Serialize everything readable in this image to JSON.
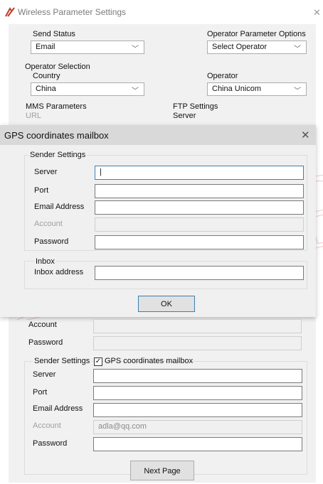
{
  "window": {
    "title": "Wireless Parameter Settings"
  },
  "send_status": {
    "label": "Send Status",
    "value": "Email"
  },
  "operator_options": {
    "label": "Operator Parameter Options",
    "value": "Select Operator"
  },
  "operator_selection": {
    "label": "Operator Selection",
    "country_label": "Country",
    "country_value": "China",
    "operator_label": "Operator",
    "operator_value": "China Unicom"
  },
  "mms": {
    "label": "MMS Parameters",
    "url_label": "URL"
  },
  "ftp": {
    "label": "FTP Settings",
    "server_label": "Server"
  },
  "dialog": {
    "title": "GPS coordinates mailbox",
    "sender_group": "Sender Settings",
    "server_label": "Server",
    "port_label": "Port",
    "email_label": "Email Address",
    "account_label": "Account",
    "password_label": "Password",
    "inbox_group": "Inbox",
    "inbox_label": "Inbox address",
    "ok_label": "OK"
  },
  "lower": {
    "account_label": "Account",
    "password_label": "Password",
    "sender_group": "Sender Settings",
    "gps_checkbox_label": "GPS coordinates mailbox",
    "gps_checked": true,
    "server_label": "Server",
    "port_label": "Port",
    "email_label": "Email Address",
    "account2_label": "Account",
    "account2_value": "adla@qq.com",
    "password2_label": "Password"
  },
  "next_button": "Next Page",
  "watermark_text": "LACORN",
  "colors": {
    "watermark": "#c0392b",
    "app_icon": "#c0392b",
    "focus_border": "#3c7fb1"
  }
}
